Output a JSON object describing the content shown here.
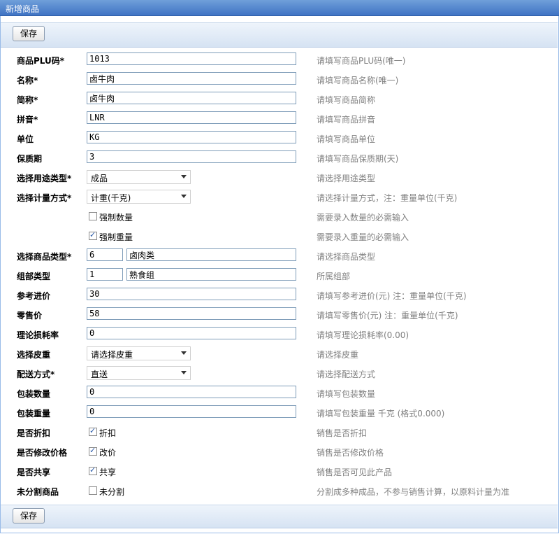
{
  "window": {
    "title": "新增商品"
  },
  "toolbar": {
    "save_label": "保存"
  },
  "fields": [
    {
      "id": "plu",
      "label": "商品PLU码*",
      "type": "text",
      "value": "1013",
      "hint": "请填写商品PLU码(唯一)"
    },
    {
      "id": "name",
      "label": "名称*",
      "type": "text",
      "value": "卤牛肉",
      "hint": "请填写商品名称(唯一)"
    },
    {
      "id": "short",
      "label": "简称*",
      "type": "text",
      "value": "卤牛肉",
      "hint": "请填写商品简称"
    },
    {
      "id": "pinyin",
      "label": "拼音*",
      "type": "text",
      "value": "LNR",
      "hint": "请填写商品拼音"
    },
    {
      "id": "unit",
      "label": "单位",
      "type": "text",
      "value": "KG",
      "hint": "请填写商品单位"
    },
    {
      "id": "shelf",
      "label": "保质期",
      "type": "text",
      "value": "3",
      "hint": "请填写商品保质期(天)"
    },
    {
      "id": "usage",
      "label": "选择用途类型*",
      "type": "select",
      "value": "成品",
      "hint": "请选择用途类型"
    },
    {
      "id": "measure",
      "label": "选择计量方式*",
      "type": "select",
      "value": "计重(千克)",
      "hint": "请选择计量方式，注：重量单位(千克)"
    },
    {
      "id": "force_qty",
      "label": "",
      "type": "checkbox",
      "checked": false,
      "cblabel": "强制数量",
      "hint": "需要录入数量的必需输入"
    },
    {
      "id": "force_wt",
      "label": "",
      "type": "checkbox",
      "checked": true,
      "cblabel": "强制重量",
      "hint": "需要录入重量的必需输入"
    },
    {
      "id": "category",
      "label": "选择商品类型*",
      "type": "pair",
      "code": "6",
      "text": "卤肉类",
      "hint": "请选择商品类型"
    },
    {
      "id": "group",
      "label": "组部类型",
      "type": "pair",
      "code": "1",
      "text": "熟食组",
      "hint": "所属组部"
    },
    {
      "id": "cost",
      "label": "参考进价",
      "type": "text",
      "value": "30",
      "hint": "请填写参考进价(元) 注：重量单位(千克)"
    },
    {
      "id": "price",
      "label": "零售价",
      "type": "text",
      "value": "58",
      "hint": "请填写零售价(元) 注：重量单位(千克)"
    },
    {
      "id": "loss",
      "label": "理论损耗率",
      "type": "text",
      "value": "0",
      "hint": "请填写理论损耗率(0.00)"
    },
    {
      "id": "tare",
      "label": "选择皮重",
      "type": "select",
      "value": "请选择皮重",
      "hint": "请选择皮重"
    },
    {
      "id": "delivery",
      "label": "配送方式*",
      "type": "select",
      "value": "直送",
      "hint": "请选择配送方式"
    },
    {
      "id": "packqty",
      "label": "包装数量",
      "type": "text",
      "value": "0",
      "hint": "请填写包装数量"
    },
    {
      "id": "packwt",
      "label": "包装重量",
      "type": "text",
      "value": "0",
      "hint": "请填写包装重量 千克 (格式0.000)"
    },
    {
      "id": "discount",
      "label": "是否折扣",
      "type": "checkbox",
      "checked": true,
      "cblabel": "折扣",
      "hint": "销售是否折扣"
    },
    {
      "id": "editprice",
      "label": "是否修改价格",
      "type": "checkbox",
      "checked": true,
      "cblabel": "改价",
      "hint": "销售是否修改价格"
    },
    {
      "id": "share",
      "label": "是否共享",
      "type": "checkbox",
      "checked": true,
      "cblabel": "共享",
      "hint": "销售是否可见此产品"
    },
    {
      "id": "split",
      "label": "未分割商品",
      "type": "checkbox",
      "checked": false,
      "cblabel": "未分割",
      "hint": "分割成多种成品，不参与销售计算，以原料计量为准"
    }
  ]
}
